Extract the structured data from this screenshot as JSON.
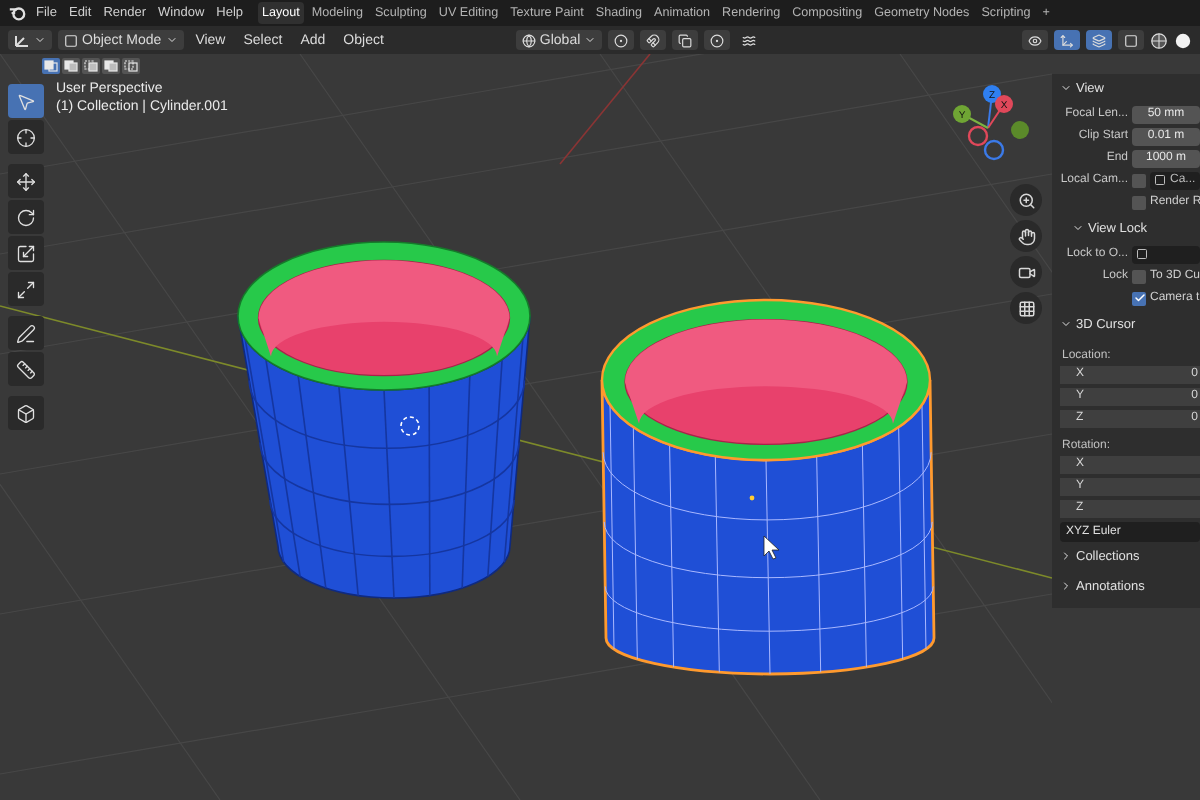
{
  "menu": [
    "File",
    "Edit",
    "Render",
    "Window",
    "Help"
  ],
  "workspace_tabs": [
    {
      "label": "Layout",
      "selected": true
    },
    {
      "label": "Modeling",
      "selected": false
    },
    {
      "label": "Sculpting",
      "selected": false
    },
    {
      "label": "UV Editing",
      "selected": false
    },
    {
      "label": "Texture Paint",
      "selected": false
    },
    {
      "label": "Shading",
      "selected": false
    },
    {
      "label": "Animation",
      "selected": false
    },
    {
      "label": "Rendering",
      "selected": false
    },
    {
      "label": "Compositing",
      "selected": false
    },
    {
      "label": "Geometry Nodes",
      "selected": false
    },
    {
      "label": "Scripting",
      "selected": false
    }
  ],
  "add_workspace": "+",
  "header": {
    "mode": "Object Mode",
    "menus": [
      "View",
      "Select",
      "Add",
      "Object"
    ],
    "orientation": "Global",
    "toggles": [
      {
        "kind": "visibility",
        "on": false
      },
      {
        "kind": "gizmo",
        "on": true
      },
      {
        "kind": "overlays",
        "on": true
      },
      {
        "kind": "xray",
        "on": false
      }
    ],
    "shading": [
      {
        "kind": "wireframe",
        "selected": false
      },
      {
        "kind": "solid",
        "selected": true
      }
    ]
  },
  "selection_modes": [
    {
      "kind": "set",
      "selected": true
    },
    {
      "kind": "extend",
      "selected": false
    },
    {
      "kind": "subtract",
      "selected": false
    },
    {
      "kind": "difference",
      "selected": false
    },
    {
      "kind": "intersect",
      "selected": false
    }
  ],
  "tool_groups": [
    {
      "tools": [
        {
          "kind": "select",
          "selected": true
        },
        {
          "kind": "cursor",
          "selected": false
        }
      ]
    },
    {
      "tools": [
        {
          "kind": "move",
          "selected": false
        },
        {
          "kind": "rotate",
          "selected": false
        },
        {
          "kind": "scale",
          "selected": false
        },
        {
          "kind": "transform",
          "selected": false
        }
      ]
    },
    {
      "tools": [
        {
          "kind": "annotate",
          "selected": false
        },
        {
          "kind": "measure",
          "selected": false
        }
      ]
    },
    {
      "tools": [
        {
          "kind": "add-cube",
          "selected": false
        }
      ]
    }
  ],
  "viewport": {
    "view_name": "User Perspective",
    "object_info": "(1) Collection | Cylinder.001",
    "objects": [
      {
        "selected": false
      },
      {
        "selected": true
      }
    ],
    "gizmo_axes": [
      "Z",
      "X",
      "Y"
    ]
  },
  "sidebar": {
    "rows": [
      {
        "kind": "section",
        "title": "View",
        "expanded": true
      },
      {
        "kind": "field",
        "label": "Focal Len...",
        "value": "50 mm"
      },
      {
        "kind": "field",
        "label": "Clip Start",
        "value": "0.01 m"
      },
      {
        "kind": "field",
        "label": "End",
        "value": "1000 m"
      },
      {
        "kind": "picker",
        "label": "Local Cam...",
        "checked": false,
        "value": "Ca..."
      },
      {
        "kind": "checkbox",
        "text": "Render R",
        "checked": false
      },
      {
        "kind": "subsection",
        "title": "View Lock",
        "expanded": true
      },
      {
        "kind": "picker",
        "label": "Lock to O..."
      },
      {
        "kind": "checkbox",
        "label": "Lock",
        "text": "To 3D Cu",
        "checked": false
      },
      {
        "kind": "checkbox",
        "text": "Camera t",
        "checked": true
      },
      {
        "kind": "section",
        "title": "3D Cursor",
        "expanded": true
      },
      {
        "kind": "caption",
        "text": "Location:"
      },
      {
        "kind": "axis",
        "axis": "X",
        "value": "0"
      },
      {
        "kind": "axis",
        "axis": "Y",
        "value": "0"
      },
      {
        "kind": "axis",
        "axis": "Z",
        "value": "0"
      },
      {
        "kind": "caption",
        "text": "Rotation:"
      },
      {
        "kind": "axis",
        "axis": "X"
      },
      {
        "kind": "axis",
        "axis": "Y"
      },
      {
        "kind": "axis",
        "axis": "Z"
      },
      {
        "kind": "dropdown",
        "value": "XYZ Euler"
      },
      {
        "kind": "section",
        "title": "Collections",
        "expanded": false
      },
      {
        "kind": "section",
        "title": "Annotations",
        "expanded": false
      }
    ]
  }
}
